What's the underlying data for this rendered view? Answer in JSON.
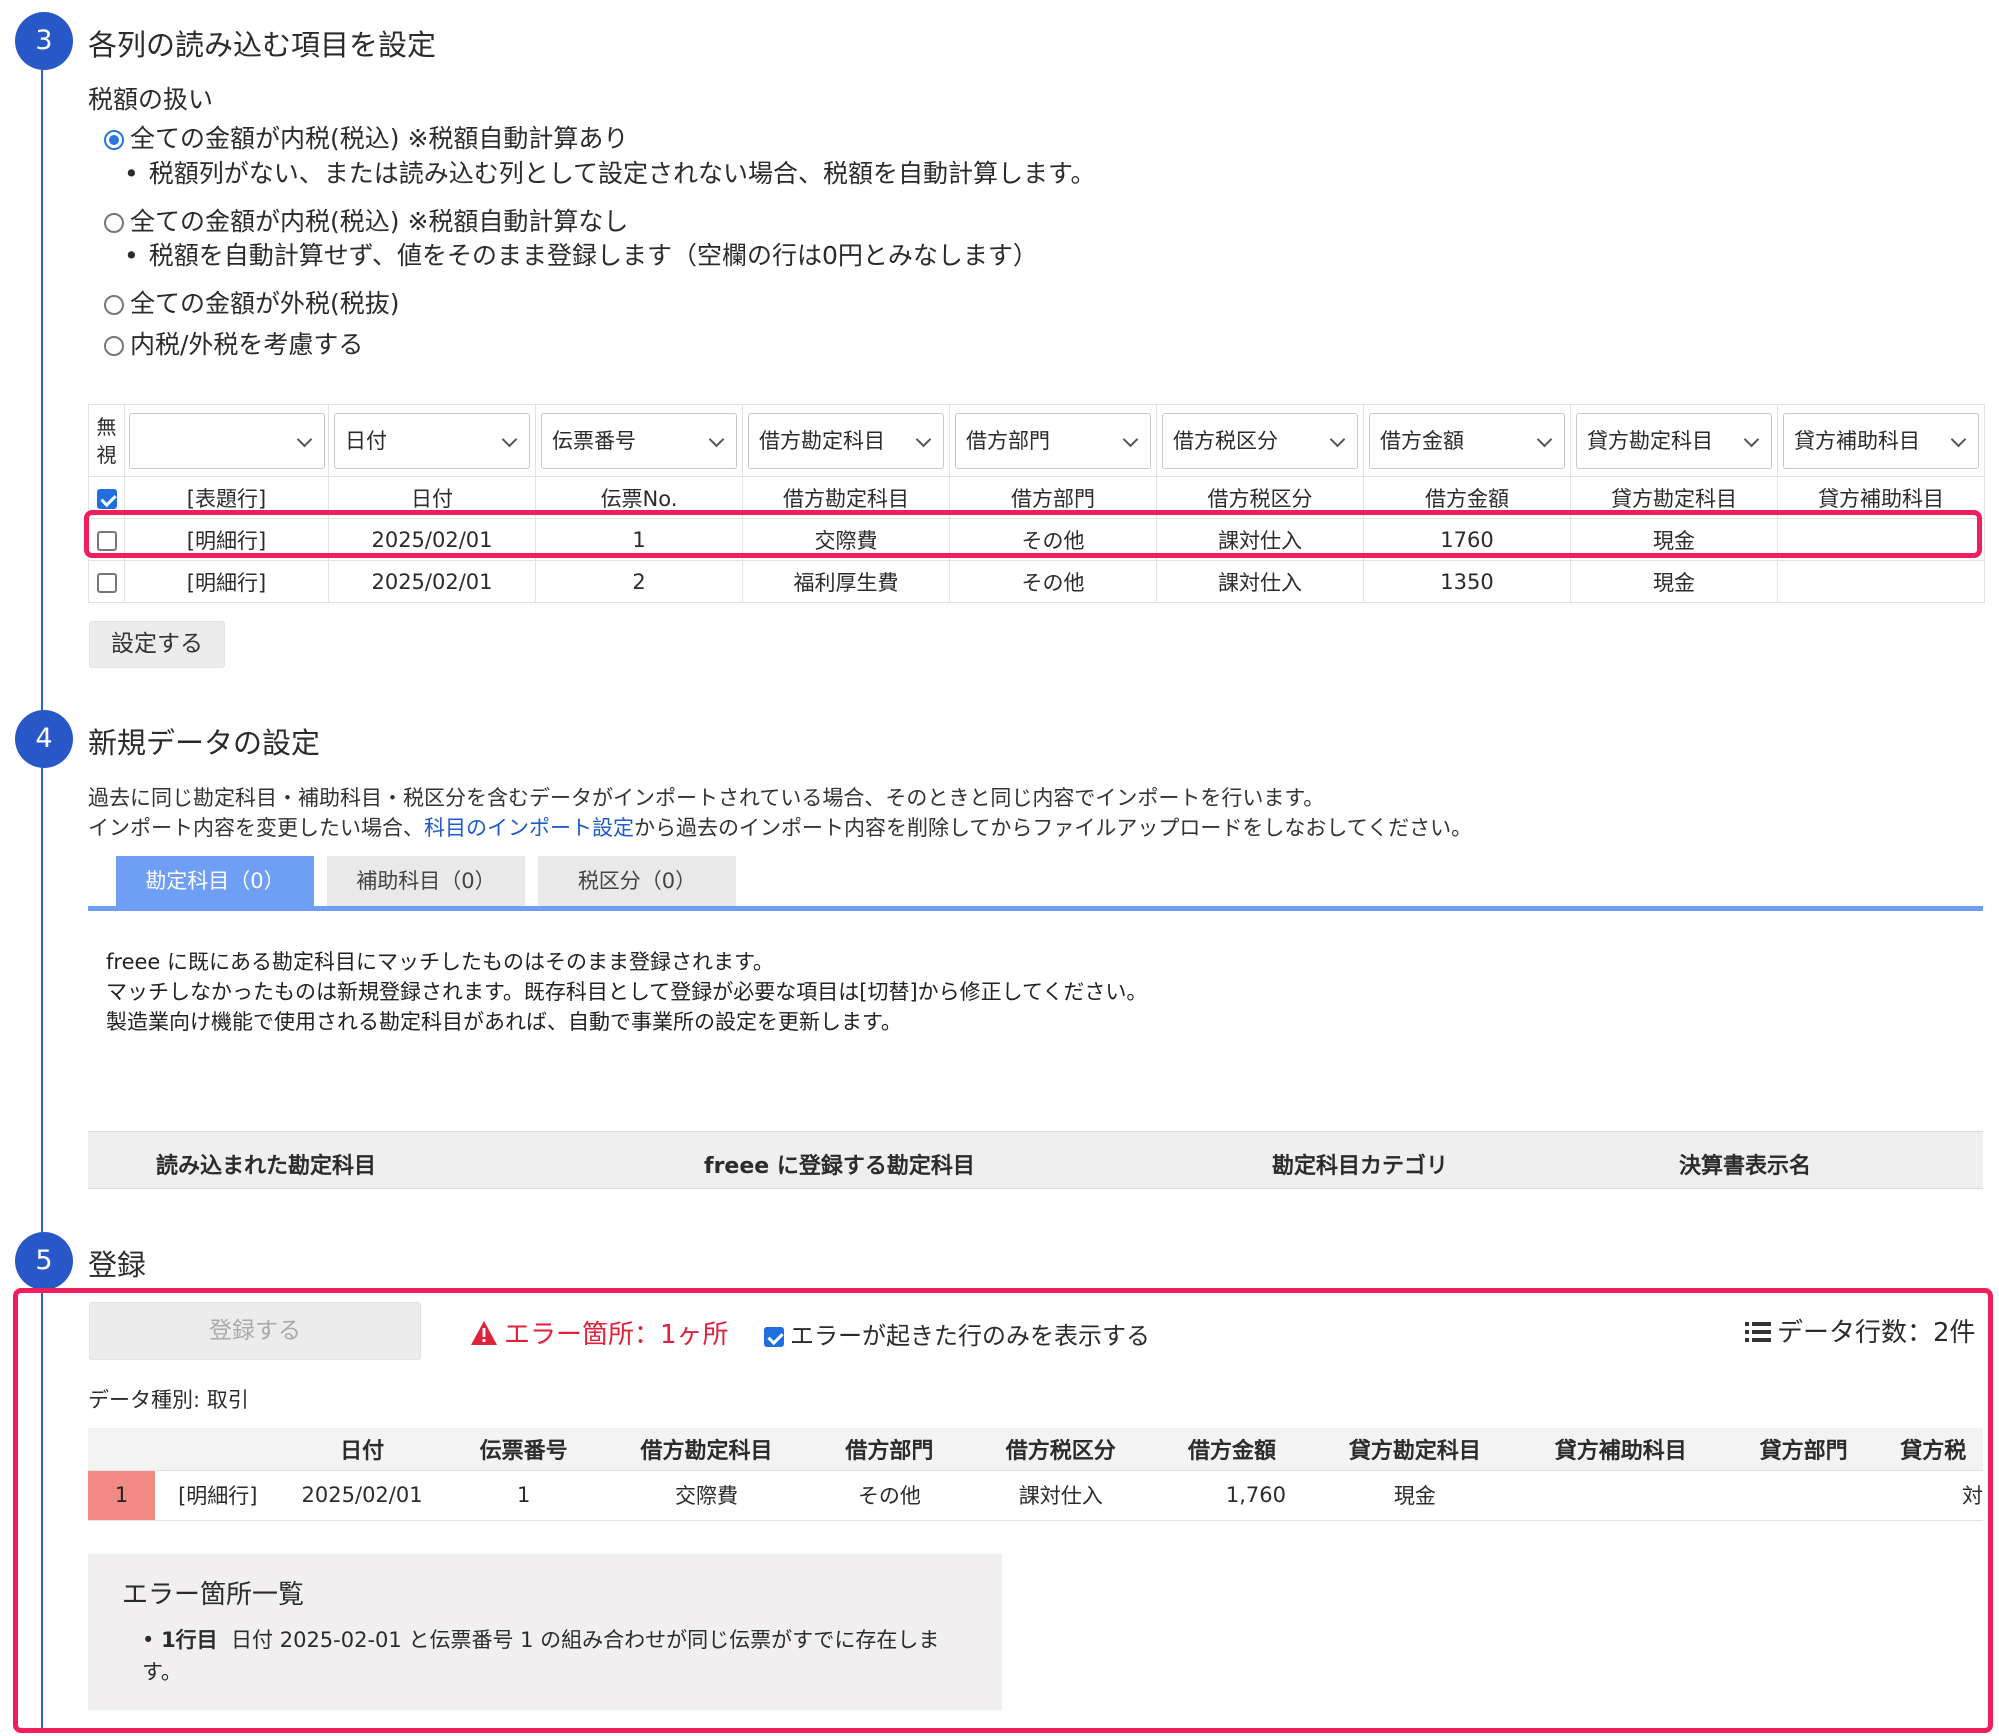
{
  "step3": {
    "number": "3",
    "title": "各列の読み込む項目を設定",
    "tax_label": "税額の扱い",
    "options": [
      {
        "label": "全ての金額が内税(税込) ※税額自動計算あり",
        "note": "税額列がない、または読み込む列として設定されない場合、税額を自動計算します。",
        "selected": true
      },
      {
        "label": "全ての金額が内税(税込) ※税額自動計算なし",
        "note": "税額を自動計算せず、値をそのまま登録します（空欄の行は0円とみなします）",
        "selected": false
      },
      {
        "label": "全ての金額が外税(税抜)",
        "note": "",
        "selected": false
      },
      {
        "label": "内税/外税を考慮する",
        "note": "",
        "selected": false
      }
    ],
    "ignore_header": "無視",
    "selects": [
      "",
      "日付",
      "伝票番号",
      "借方勘定科目",
      "借方部門",
      "借方税区分",
      "借方金額",
      "貸方勘定科目",
      "貸方補助科目"
    ],
    "rows": [
      {
        "checked": true,
        "cells": [
          "[表題行]",
          "日付",
          "伝票No.",
          "借方勘定科目",
          "借方部門",
          "借方税区分",
          "借方金額",
          "貸方勘定科目",
          "貸方補助科目"
        ]
      },
      {
        "checked": false,
        "cells": [
          "[明細行]",
          "2025/02/01",
          "1",
          "交際費",
          "その他",
          "課対仕入",
          "1760",
          "現金",
          ""
        ]
      },
      {
        "checked": false,
        "cells": [
          "[明細行]",
          "2025/02/01",
          "2",
          "福利厚生費",
          "その他",
          "課対仕入",
          "1350",
          "現金",
          ""
        ]
      }
    ],
    "apply_button": "設定する"
  },
  "step4": {
    "number": "4",
    "title": "新規データの設定",
    "desc1": "過去に同じ勘定科目・補助科目・税区分を含むデータがインポートされている場合、そのときと同じ内容でインポートを行います。",
    "desc2_pre": "インポート内容を変更したい場合、",
    "desc2_link": "科目のインポート設定",
    "desc2_post": "から過去のインポート内容を削除してからファイルアップロードをしなおしてください。",
    "tabs": [
      "勘定科目（0）",
      "補助科目（0）",
      "税区分（0）"
    ],
    "info": [
      "freee に既にある勘定科目にマッチしたものはそのまま登録されます。",
      "マッチしなかったものは新規登録されます。既存科目として登録が必要な項目は[切替]から修正してください。",
      "製造業向け機能で使用される勘定科目があれば、自動で事業所の設定を更新します。"
    ],
    "columns": [
      "読み込まれた勘定科目",
      "freee に登録する勘定科目",
      "勘定科目カテゴリ",
      "決算書表示名"
    ]
  },
  "step5": {
    "number": "5",
    "title": "登録",
    "register_button": "登録する",
    "error_summary": "エラー箇所：1ヶ所",
    "show_errors_only": "エラーが起きた行のみを表示する",
    "show_errors_checked": true,
    "row_count": "データ行数：2件",
    "data_kind": "データ種別: 取引",
    "headers": [
      "",
      "",
      "日付",
      "伝票番号",
      "借方勘定科目",
      "借方部門",
      "借方税区分",
      "借方金額",
      "貸方勘定科目",
      "貸方補助科目",
      "貸方部門",
      "貸方税"
    ],
    "row": [
      "1",
      "[明細行]",
      "2025/02/01",
      "1",
      "交際費",
      "その他",
      "課対仕入",
      "1,760",
      "現金",
      "",
      "",
      "対"
    ],
    "error_list_title": "エラー箇所一覧",
    "error_item_bold": "1行目",
    "error_item_text": "日付 2025-02-01 と伝票番号 1 の組み合わせが同じ伝票がすでに存在します。"
  },
  "colors": {
    "accent": "#2858c8",
    "highlight": "#f01f5c",
    "tab_active": "#6f9ef5",
    "error": "#e0213a",
    "error_cell": "#f28b86"
  }
}
